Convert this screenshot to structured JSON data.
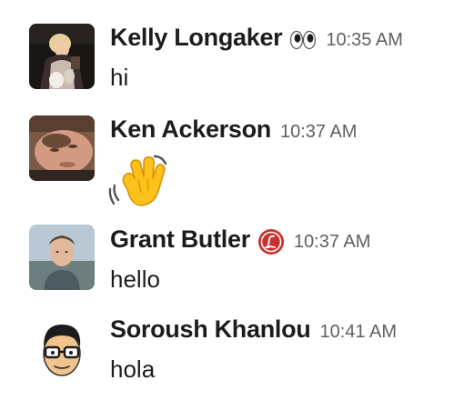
{
  "messages": [
    {
      "sender": "Kelly Longaker",
      "status_icon": "eyes-icon",
      "timestamp": "10:35 AM",
      "text": "hi"
    },
    {
      "sender": "Ken Ackerson",
      "status_icon": "",
      "timestamp": "10:37 AM",
      "text": "",
      "emoji": "waving-hand-icon"
    },
    {
      "sender": "Grant Butler",
      "status_icon": "l-badge-icon",
      "timestamp": "10:37 AM",
      "text": "hello"
    },
    {
      "sender": "Soroush Khanlou",
      "status_icon": "",
      "timestamp": "10:41 AM",
      "text": "hola"
    }
  ],
  "colors": {
    "sender": "#1d1c1d",
    "timestamp": "#616061",
    "badge_red": "#c8302c",
    "wave_yellow": "#fcc21b"
  }
}
